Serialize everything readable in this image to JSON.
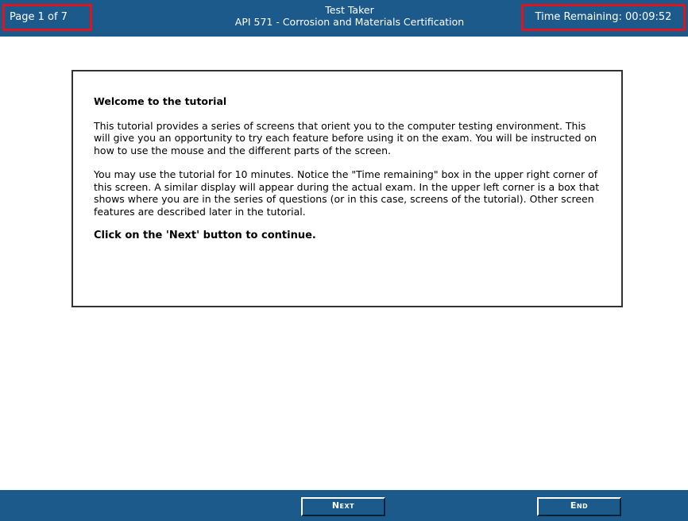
{
  "header": {
    "page_indicator": "Page 1 of 7",
    "user_name": "Test Taker",
    "exam_title": "API 571 - Corrosion and Materials Certification",
    "time_remaining": "Time Remaining: 00:09:52"
  },
  "content": {
    "title": "Welcome to the tutorial",
    "paragraphs": [
      "This tutorial provides a series of screens that orient you to the computer testing environment. This will give you an opportunity to try each feature before using it on the exam. You will be instructed on how to use the mouse and the different parts of the screen.",
      "You may use the tutorial for 10 minutes. Notice the \"Time remaining\" box in the upper right corner of this screen. A similar display will appear during the actual exam. In the upper left corner is a box that shows where you are in the series of questions (or in this case, screens of the tutorial). Other screen features are described later in the tutorial."
    ],
    "call_to_action": "Click on the 'Next' button to continue."
  },
  "footer": {
    "next_label": "Next",
    "end_label": "End"
  },
  "colors": {
    "bar_background": "#1c5a8c",
    "highlight_border": "#e0141e"
  }
}
